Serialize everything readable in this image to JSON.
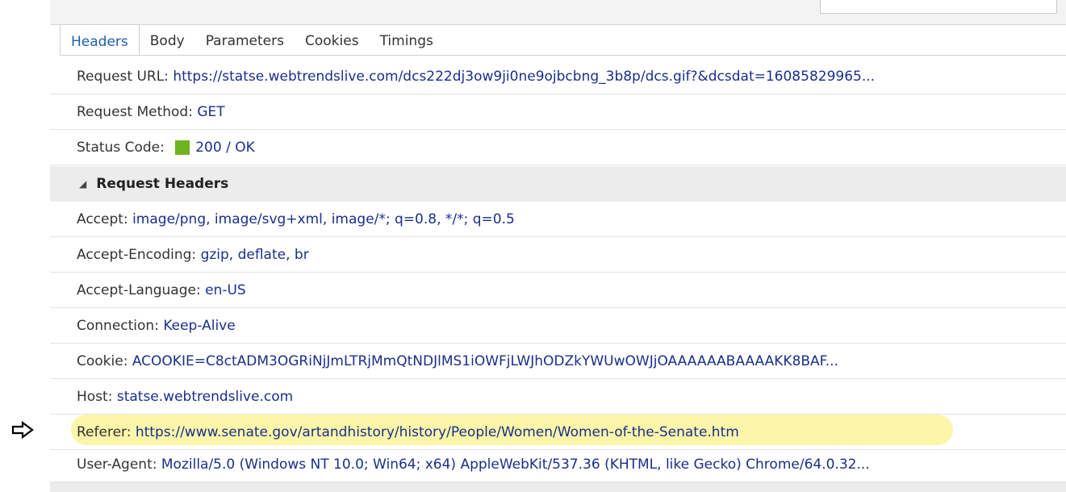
{
  "tabs": [
    {
      "label": "Headers",
      "active": true
    },
    {
      "label": "Body",
      "active": false
    },
    {
      "label": "Parameters",
      "active": false
    },
    {
      "label": "Cookies",
      "active": false
    },
    {
      "label": "Timings",
      "active": false
    }
  ],
  "general": {
    "url_key": "Request URL: ",
    "url_value": "https://statse.webtrendslive.com/dcs222dj3ow9ji0ne9ojbcbng_3b8p/dcs.gif?&dcsdat=16085829965...",
    "method_key": "Request Method: ",
    "method_value": "GET",
    "status_key": "Status Code: ",
    "status_value": "200 / OK",
    "status_color": "#6fb320"
  },
  "section": {
    "label": "Request Headers",
    "icon": "triangle-collapse-icon"
  },
  "headers": [
    {
      "key": "Accept: ",
      "value": "image/png, image/svg+xml, image/*; q=0.8, */*; q=0.5"
    },
    {
      "key": "Accept-Encoding: ",
      "value": "gzip, deflate, br"
    },
    {
      "key": "Accept-Language: ",
      "value": "en-US"
    },
    {
      "key": "Connection: ",
      "value": "Keep-Alive"
    },
    {
      "key": "Cookie: ",
      "value": "ACOOKIE=C8ctADM3OGRiNjJmLTRjMmQtNDJlMS1iOWFjLWJhODZkYWUwOWJjOAAAAAABAAAAKK8BAF..."
    },
    {
      "key": "Host: ",
      "value": "statse.webtrendslive.com"
    },
    {
      "key": "Referer: ",
      "value": "https://www.senate.gov/artandhistory/history/People/Women/Women-of-the-Senate.htm"
    },
    {
      "key": "User-Agent: ",
      "value": "Mozilla/5.0 (Windows NT 10.0; Win64; x64) AppleWebKit/537.36 (KHTML, like Gecko) Chrome/64.0.32..."
    }
  ],
  "annotation": {
    "arrow_icon": "right-arrow-outline-icon",
    "highlight_color": "#fbf6a9"
  }
}
